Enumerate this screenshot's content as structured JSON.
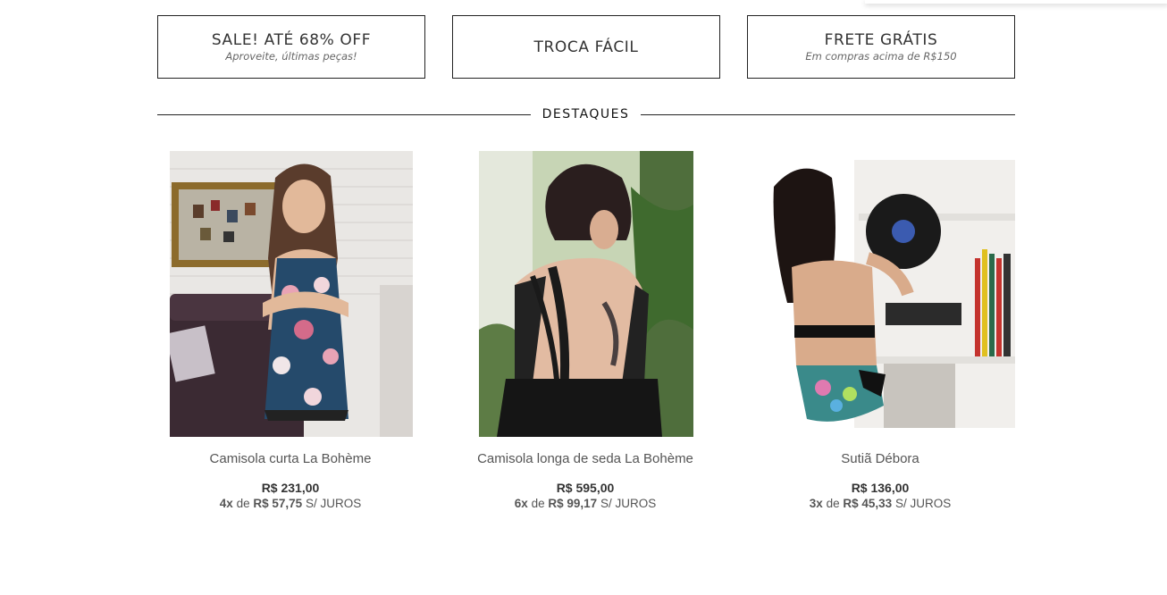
{
  "banners": [
    {
      "title": "SALE! ATÉ 68% OFF",
      "subtitle": "Aproveite, últimas peças!"
    },
    {
      "title": "TROCA FÁCIL",
      "subtitle": ""
    },
    {
      "title": "FRETE GRÁTIS",
      "subtitle": "Em compras acima de R$150"
    }
  ],
  "section": {
    "title": "DESTAQUES"
  },
  "products": [
    {
      "name": "Camisola curta La Bohème",
      "price": "R$ 231,00",
      "installments": "4x",
      "installment_prefix": "de",
      "installment_value": "R$ 57,75",
      "installment_suffix": "S/ JUROS"
    },
    {
      "name": "Camisola longa de seda La Bohème",
      "price": "R$ 595,00",
      "installments": "6x",
      "installment_prefix": "de",
      "installment_value": "R$ 99,17",
      "installment_suffix": "S/ JUROS"
    },
    {
      "name": "Sutiã Débora",
      "price": "R$ 136,00",
      "installments": "3x",
      "installment_prefix": "de",
      "installment_value": "R$ 45,33",
      "installment_suffix": "S/ JUROS"
    }
  ]
}
